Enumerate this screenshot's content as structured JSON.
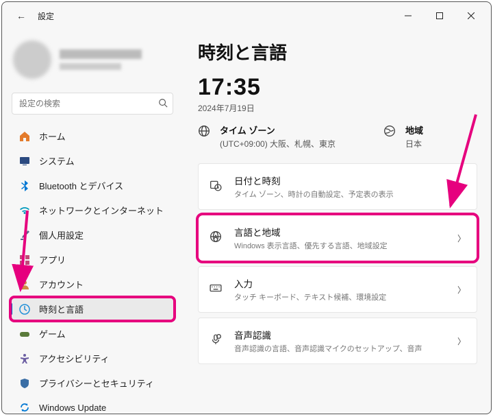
{
  "window": {
    "title": "設定"
  },
  "sidebar": {
    "search_placeholder": "設定の検索",
    "items": [
      {
        "label": "ホーム"
      },
      {
        "label": "システム"
      },
      {
        "label": "Bluetooth とデバイス"
      },
      {
        "label": "ネットワークとインターネット"
      },
      {
        "label": "個人用設定"
      },
      {
        "label": "アプリ"
      },
      {
        "label": "アカウント"
      },
      {
        "label": "時刻と言語"
      },
      {
        "label": "ゲーム"
      },
      {
        "label": "アクセシビリティ"
      },
      {
        "label": "プライバシーとセキュリティ"
      },
      {
        "label": "Windows Update"
      }
    ]
  },
  "main": {
    "page_title": "時刻と言語",
    "clock": "17:35",
    "date": "2024年7月19日",
    "timezone": {
      "label": "タイム ゾーン",
      "value": "(UTC+09:00) 大阪、札幌、東京"
    },
    "region": {
      "label": "地域",
      "value": "日本"
    },
    "cards": [
      {
        "title": "日付と時刻",
        "sub": "タイム ゾーン、時計の自動設定、予定表の表示"
      },
      {
        "title": "言語と地域",
        "sub": "Windows 表示言語、優先する言語、地域設定"
      },
      {
        "title": "入力",
        "sub": "タッチ キーボード、テキスト候補、環境設定"
      },
      {
        "title": "音声認識",
        "sub": "音声認識の言語、音声認識マイクのセットアップ、音声"
      }
    ]
  }
}
